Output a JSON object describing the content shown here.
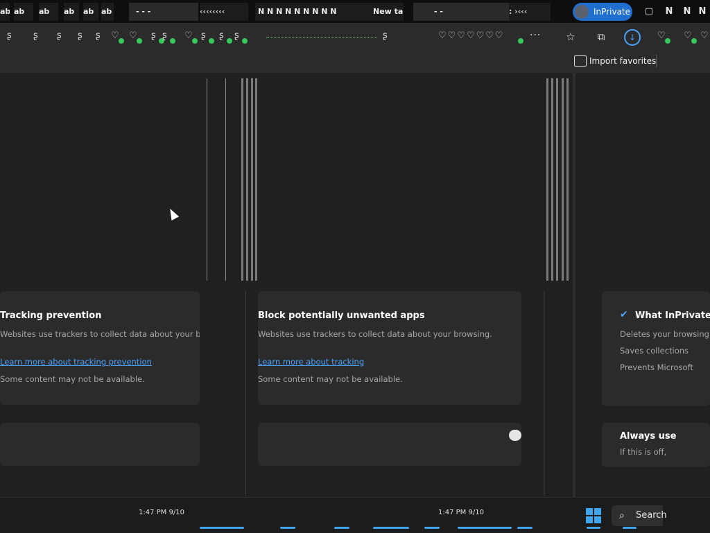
{
  "browser": {
    "tabs": [
      {
        "label": "ab"
      },
      {
        "label": "ab"
      },
      {
        "label": "ab"
      },
      {
        "label": "ab"
      },
      {
        "label": "ab"
      },
      {
        "label": "ab"
      },
      {
        "label": "- - -"
      },
      {
        "label": "N   N   N   N   N   N   N   N   N"
      },
      {
        "label": "New tab"
      },
      {
        "label": "- -"
      }
    ],
    "inprivate_label": "InPrivate",
    "favorites_bar": {
      "import_label": "Import favorites"
    },
    "more_label": "···"
  },
  "panels": [
    {
      "card1_title": "Tracking prevention",
      "card1_desc": "Websites use trackers to collect data about your browsing.",
      "card1_link": "Learn more about tracking prevention",
      "card1_note": "Some content may not be available."
    },
    {
      "card1_title": "Block potentially unwanted apps",
      "card1_desc": "Websites use trackers to collect data about your browsing.",
      "card1_link": "Learn more about tracking",
      "card1_note": "Some content may not be available."
    },
    {
      "card1_title": "What InPrivate does",
      "card1_lines": [
        "Deletes your browsing data",
        "Saves collections",
        "Prevents Microsoft"
      ],
      "card2_title": "Always use",
      "card2_desc": "If this is off,"
    }
  ],
  "taskbar": {
    "search_label": "Search",
    "tray_left": "1:47 PM  9/10",
    "tray_right": "1:47 PM  9/10"
  },
  "icons": {
    "favorite": "star-icon",
    "collections": "collections-icon",
    "downloads": "download-icon",
    "more": "more-icon",
    "check": "check-icon",
    "search": "search-icon",
    "windows": "windows-logo-icon"
  },
  "colors": {
    "accent": "#4aa3ff",
    "inprivate": "#1f6fd1",
    "background": "#202020"
  }
}
